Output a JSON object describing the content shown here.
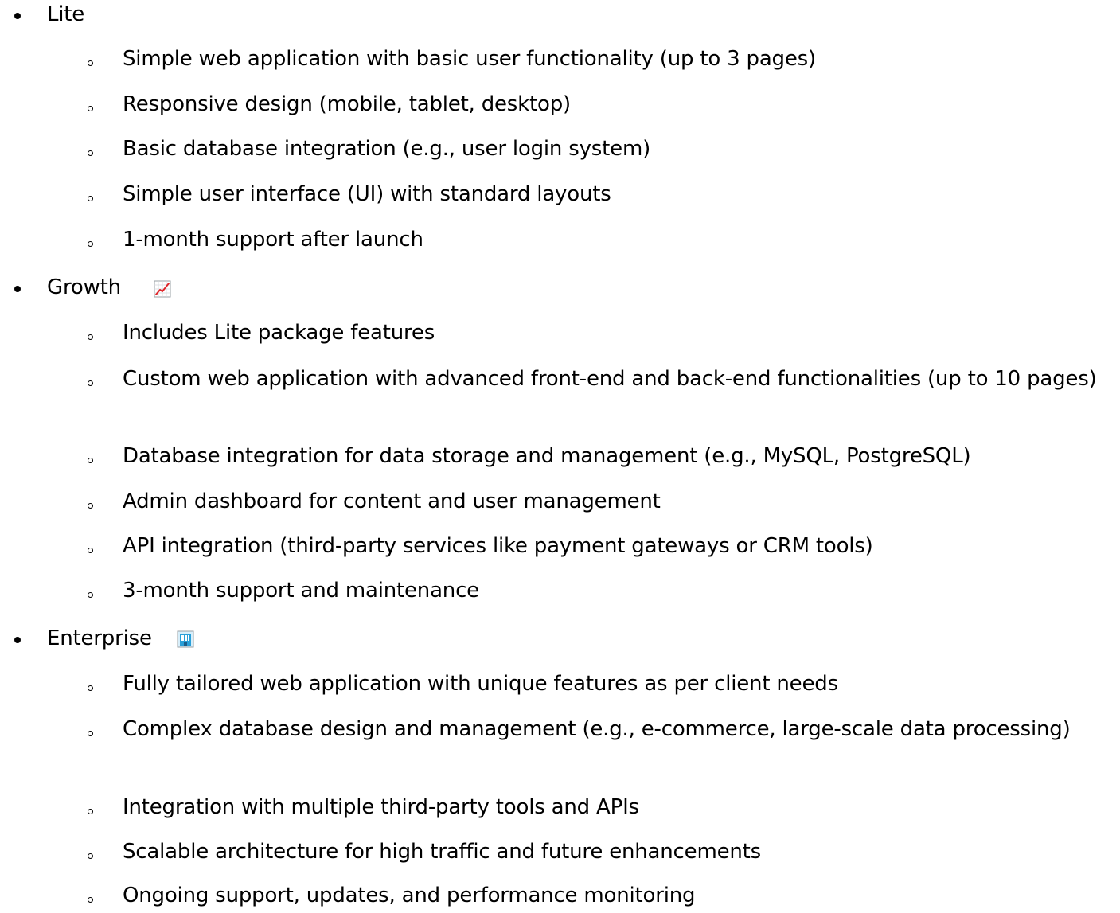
{
  "tiers": [
    {
      "label": "Lite",
      "items": [
        "Simple web application with basic user functionality (up to 3 pages)",
        "Responsive design (mobile, tablet, desktop)",
        "Basic database integration (e.g., user login system)",
        "Simple user interface (UI) with standard layouts",
        "1-month support after launch"
      ]
    },
    {
      "label": "Growth",
      "icon": "chart-increasing-icon",
      "items": [
        "Includes Lite package features",
        "Custom web application with advanced front-end and back-end functionalities (up to 10 pages)",
        "Database integration for data storage and management (e.g., MySQL, PostgreSQL)",
        "Admin dashboard for content and user management",
        "API integration (third-party services like payment gateways or CRM tools)",
        "3-month support and maintenance"
      ]
    },
    {
      "label": "Enterprise",
      "icon": "office-building-icon",
      "items": [
        "Fully tailored web application with unique features as per client needs",
        "Complex database design and management (e.g., e-commerce, large-scale data processing)",
        "Integration with multiple third-party tools and APIs",
        "Scalable architecture for high traffic and future enhancements",
        "Ongoing support, updates, and performance monitoring"
      ]
    }
  ],
  "colors": {
    "text": "#000000",
    "chart_line": "#e0262a",
    "building": "#2a9fd8"
  }
}
